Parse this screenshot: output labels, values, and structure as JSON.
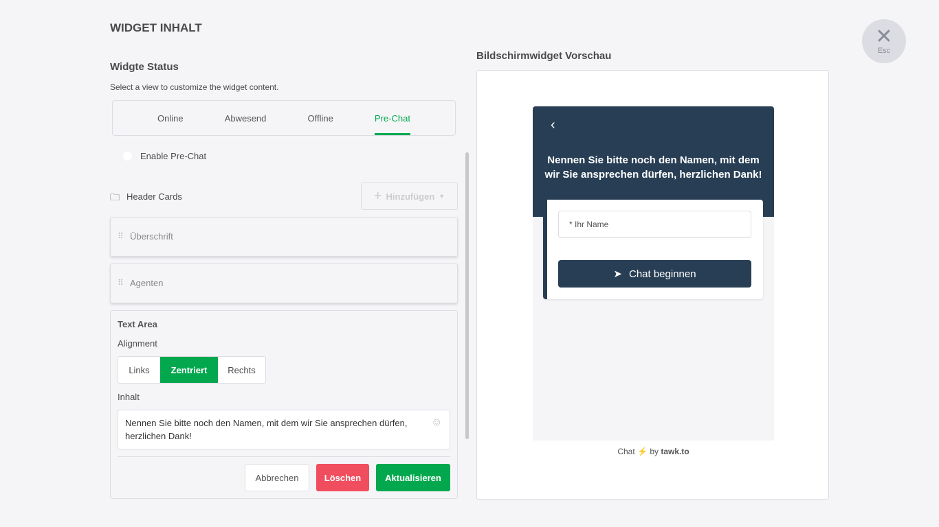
{
  "title": "WIDGET INHALT",
  "close": {
    "label": "Esc"
  },
  "status": {
    "heading": "Widgte Status",
    "description": "Select a view to customize the widget content.",
    "tabs": [
      {
        "label": "Online"
      },
      {
        "label": "Abwesend"
      },
      {
        "label": "Offline"
      },
      {
        "label": "Pre-Chat",
        "active": true
      }
    ]
  },
  "enable_prechat": "Enable Pre-Chat",
  "header_cards": {
    "label": "Header Cards",
    "add_label": "Hinzufügen",
    "cards": [
      {
        "label": "Überschrift"
      },
      {
        "label": "Agenten"
      }
    ]
  },
  "text_area": {
    "title": "Text Area",
    "alignment_label": "Alignment",
    "alignments": [
      "Links",
      "Zentriert",
      "Rechts"
    ],
    "selected_alignment": "Zentriert",
    "content_label": "Inhalt",
    "content": "Nennen Sie bitte noch den Namen, mit dem wir Sie ansprechen dürfen, herzlichen Dank!",
    "cancel": "Abbrechen",
    "delete": "Löschen",
    "update": "Aktualisieren"
  },
  "preview": {
    "heading": "Bildschirmwidget Vorschau",
    "message": "Nennen Sie bitte noch den Namen, mit dem wir Sie ansprechen dürfen, herzlichen Dank!",
    "name_placeholder": "* Ihr Name",
    "start_button": "Chat beginnen",
    "footer_chat": "Chat",
    "footer_by": "by",
    "footer_brand": "tawk.to"
  },
  "colors": {
    "accent": "#03a84e",
    "danger": "#f04e5e",
    "widget": "#283e54"
  }
}
